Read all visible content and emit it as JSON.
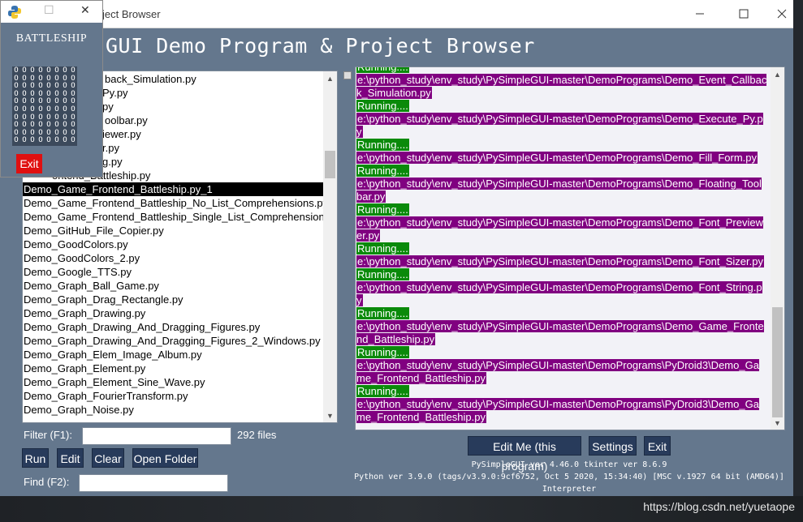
{
  "window": {
    "title": "ject Browser"
  },
  "header": {
    "title": "GUI Demo Program & Project Browser"
  },
  "file_list": {
    "items": [
      "back_Simulation.py",
      "Py.py",
      "py",
      "oolbar.py",
      "iewer.py",
      "r.py",
      "g.py",
      "ontend_Battleship.py",
      "Demo_Game_Frontend_Battleship.py_1",
      "Demo_Game_Frontend_Battleship_No_List_Comprehensions.py",
      "Demo_Game_Frontend_Battleship_Single_List_Comprehension",
      "Demo_GitHub_File_Copier.py",
      "Demo_GoodColors.py",
      "Demo_GoodColors_2.py",
      "Demo_Google_TTS.py",
      "Demo_Graph_Ball_Game.py",
      "Demo_Graph_Drag_Rectangle.py",
      "Demo_Graph_Drawing.py",
      "Demo_Graph_Drawing_And_Dragging_Figures.py",
      "Demo_Graph_Drawing_And_Dragging_Figures_2_Windows.py",
      "Demo_Graph_Elem_Image_Album.py",
      "Demo_Graph_Element.py",
      "Demo_Graph_Element_Sine_Wave.py",
      "Demo_Graph_FourierTransform.py",
      "Demo_Graph_Noise.py"
    ]
  },
  "output": {
    "running_label": "Running....",
    "paths": [
      "e:\\python_study\\env_study\\PySimpleGUI-master\\DemoPrograms\\Demo_Event_Callback_Simulation.py",
      "e:\\python_study\\env_study\\PySimpleGUI-master\\DemoPrograms\\Demo_Execute_Py.py",
      "e:\\python_study\\env_study\\PySimpleGUI-master\\DemoPrograms\\Demo_Fill_Form.py",
      "e:\\python_study\\env_study\\PySimpleGUI-master\\DemoPrograms\\Demo_Floating_Toolbar.py",
      "e:\\python_study\\env_study\\PySimpleGUI-master\\DemoPrograms\\Demo_Font_Previewer.py",
      "e:\\python_study\\env_study\\PySimpleGUI-master\\DemoPrograms\\Demo_Font_Sizer.py",
      "e:\\python_study\\env_study\\PySimpleGUI-master\\DemoPrograms\\Demo_Font_String.py",
      "e:\\python_study\\env_study\\PySimpleGUI-master\\DemoPrograms\\Demo_Game_Frontend_Battleship.py",
      "e:\\python_study\\env_study\\PySimpleGUI-master\\DemoPrograms\\PyDroid3\\Demo_Game_Frontend_Battleship.py",
      "e:\\python_study\\env_study\\PySimpleGUI-master\\DemoPrograms\\PyDroid3\\Demo_Game_Frontend_Battleship.py"
    ]
  },
  "filter": {
    "label": "Filter (F1):",
    "value": "",
    "count": "292 files"
  },
  "buttons": {
    "run": "Run",
    "edit": "Edit",
    "clear": "Clear",
    "open_folder": "Open Folder",
    "edit_me": "Edit Me (this program)",
    "settings": "Settings",
    "exit": "Exit"
  },
  "find": {
    "label": "Find (F2):",
    "value": ""
  },
  "info": {
    "version_line": "PySimpleGUI ver 4.46.0  tkinter ver 8.6.9",
    "python_line": "Python ver 3.9.0 (tags/v3.9.0:9cf6752, Oct  5 2020, 15:34:40) [MSC v.1927 64 bit (AMD64)]",
    "interpreter": "Interpreter"
  },
  "battleship": {
    "title": "BATTLESHIP",
    "grid_rows": 10,
    "grid_cols": 8,
    "cell_symbol": "O",
    "exit_label": "Exit"
  },
  "watermark": "https://blog.csdn.net/yuetaope",
  "colors": {
    "window_bg": "#64778d",
    "button_bg": "#283b5b",
    "running_bg": "#0a8a0a",
    "path_bg": "#800080",
    "exit_red": "#e01010"
  }
}
